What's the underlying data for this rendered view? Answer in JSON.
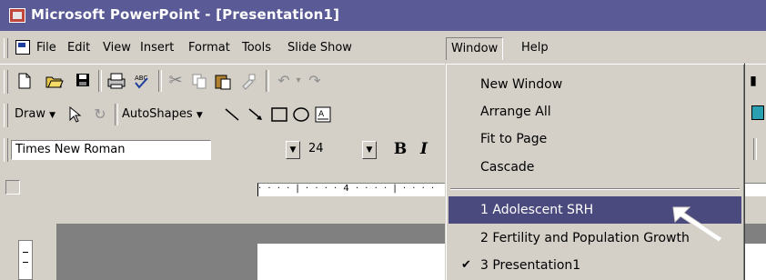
{
  "window": {
    "title": "Microsoft PowerPoint - [Presentation1]"
  },
  "menubar": {
    "items": [
      {
        "label": "File"
      },
      {
        "label": "Edit"
      },
      {
        "label": "View"
      },
      {
        "label": "Insert"
      },
      {
        "label": "Format"
      },
      {
        "label": "Tools"
      },
      {
        "label": "Slide Show"
      },
      {
        "label": "Window"
      },
      {
        "label": "Help"
      }
    ]
  },
  "drawing_toolbar": {
    "draw_label": "Draw",
    "autoshapes_label": "AutoShapes"
  },
  "formatting_toolbar": {
    "font_name": "Times New Roman",
    "font_size": "24",
    "bold_label": "B",
    "italic_label": "I"
  },
  "ruler": {
    "text": "· · · · | · · · · 4 · · · · | · · · ·"
  },
  "window_menu": {
    "items": [
      {
        "label": "New Window"
      },
      {
        "label": "Arrange All"
      },
      {
        "label": "Fit to Page"
      },
      {
        "label": "Cascade"
      }
    ],
    "recent": [
      {
        "label": "1 Adolescent SRH",
        "highlighted": true
      },
      {
        "label": "2 Fertility and Population Growth",
        "highlighted": false
      },
      {
        "label": "3 Presentation1",
        "checked": true
      }
    ]
  },
  "icons": {
    "app": "powerpoint-icon",
    "new": "new-document-icon",
    "open": "open-folder-icon",
    "save": "save-icon",
    "print": "print-icon",
    "spelling": "spelling-icon",
    "cut": "cut-icon",
    "copy": "copy-icon",
    "paste": "paste-icon",
    "format_painter": "format-painter-icon",
    "undo": "undo-icon",
    "redo": "redo-icon",
    "select": "select-arrow-icon",
    "rotate": "free-rotate-icon",
    "line": "line-icon",
    "arrow": "arrow-icon",
    "rectangle": "rectangle-icon",
    "oval": "oval-icon",
    "textbox": "text-box-icon",
    "check": "check-icon",
    "cursor": "mouse-cursor-icon"
  },
  "colors": {
    "titlebar": "#5a5a96",
    "highlight": "#4b4a7e",
    "chrome": "#d4d0c8"
  }
}
